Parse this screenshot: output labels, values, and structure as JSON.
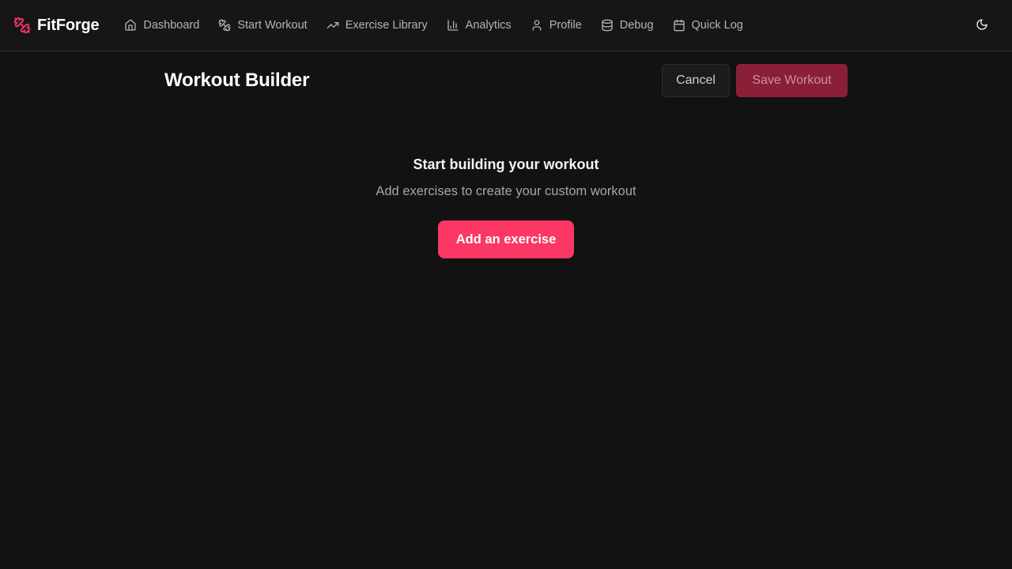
{
  "app": {
    "name": "FitForge",
    "logo_icon": "dumbbell-icon",
    "accent_color": "#fb3765"
  },
  "nav": {
    "items": [
      {
        "label": "Dashboard",
        "icon": "home-icon"
      },
      {
        "label": "Start Workout",
        "icon": "dumbbell-icon"
      },
      {
        "label": "Exercise Library",
        "icon": "trending-up-icon"
      },
      {
        "label": "Analytics",
        "icon": "bar-chart-icon"
      },
      {
        "label": "Profile",
        "icon": "user-icon"
      },
      {
        "label": "Debug",
        "icon": "database-icon"
      },
      {
        "label": "Quick Log",
        "icon": "calendar-icon"
      }
    ],
    "theme_toggle_icon": "moon-icon"
  },
  "page": {
    "title": "Workout Builder",
    "cancel_label": "Cancel",
    "save_label": "Save Workout"
  },
  "empty_state": {
    "title": "Start building your workout",
    "subtitle": "Add exercises to create your custom workout",
    "add_label": "Add an exercise"
  }
}
